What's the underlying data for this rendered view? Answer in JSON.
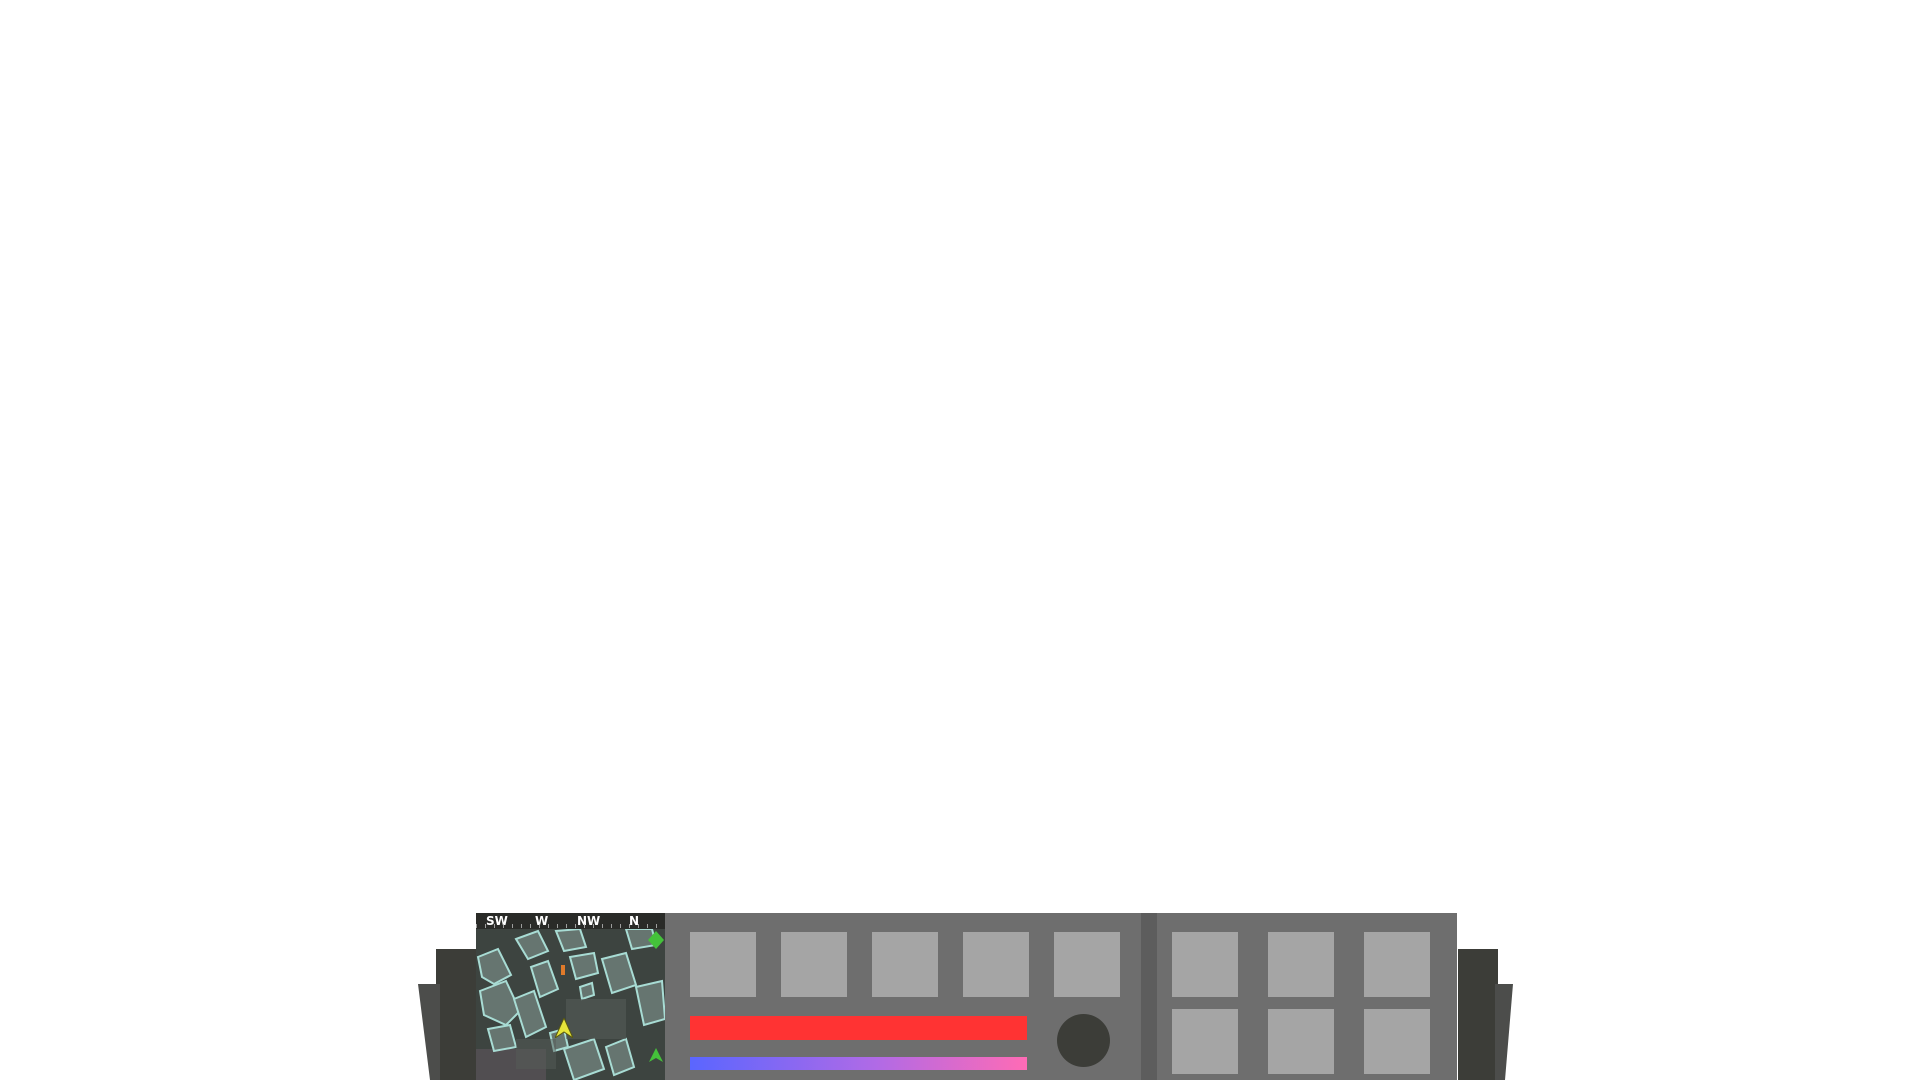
{
  "compass": {
    "labels": [
      "SW",
      "W",
      "NW",
      "N"
    ]
  },
  "minimap": {
    "icons": [
      "player-arrow-icon",
      "ally-marker-icon",
      "objective-marker-icon"
    ],
    "colors": {
      "ground": "#3d4440",
      "building": "#667570",
      "building_outline": "#a8dcd4",
      "player": "#e7e53a",
      "ally": "#44c23a"
    }
  },
  "hud": {
    "ability_slots_top": [
      "",
      "",
      "",
      "",
      ""
    ],
    "inventory_slots": [
      "",
      "",
      "",
      "",
      "",
      ""
    ],
    "health": {
      "fraction": 1.0,
      "color": "#ff3333"
    },
    "energy": {
      "fraction": 1.0,
      "gradient": [
        "#5a66ff",
        "#b06ae6",
        "#ff6bb5"
      ]
    },
    "orb_icon": "ultimate-orb-icon"
  }
}
